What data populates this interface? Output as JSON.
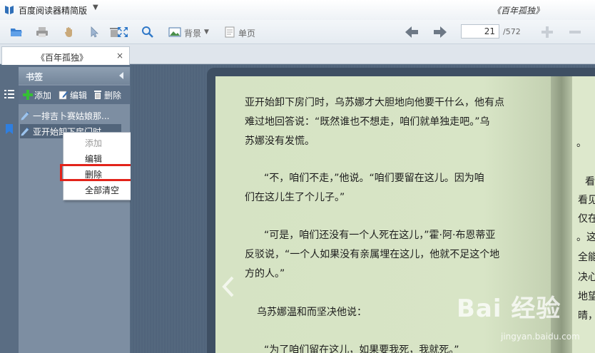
{
  "app": {
    "name": "百度阅读器精简版",
    "document_title": "《百年孤独》"
  },
  "toolbar": {
    "background_label": "背景",
    "single_page_label": "单页",
    "current_page": "21",
    "total_pages": "/572"
  },
  "tab": {
    "label": "《百年孤独》",
    "close": "×"
  },
  "bookmarks": {
    "title": "书签",
    "add_label": "添加",
    "edit_label": "编辑",
    "delete_label": "删除",
    "items": [
      {
        "label": "一排吉卜赛姑娘那..."
      },
      {
        "label": "亚开始卸下房门时..."
      }
    ]
  },
  "context_menu": {
    "items": [
      {
        "label": "添加"
      },
      {
        "label": "编辑"
      },
      {
        "label": "删除"
      },
      {
        "label": "全部清空"
      }
    ]
  },
  "book": {
    "left_lines": [
      "亚开始卸下房门时，乌苏娜才大胆地向他要干什么，他有点",
      "难过地回答说：“既然谁也不想走，咱们就单独走吧。”乌",
      "苏娜没有发慌。",
      "“不，咱们不走，”他说。“咱们要留在这儿。因为咱",
      "们在这儿生了个儿子。”",
      "“可是，咱们还没有一个人死在这儿，”霍·阿·布恩蒂亚",
      "反驳说，“一个人如果没有亲属埋在这儿，他就不足这个地",
      "方的人。”",
      "乌苏娜温和而坚决他说：",
      "“为了咱们留在这儿，如果要我死，我就死。”"
    ],
    "right_fragments": [
      "。",
      "看",
      "看见",
      "仅在",
      "。这",
      "全能",
      "决心",
      "地望",
      "晴，"
    ]
  },
  "watermark": {
    "main": "Bai 经验",
    "sub": "jingyan.baidu.com"
  }
}
